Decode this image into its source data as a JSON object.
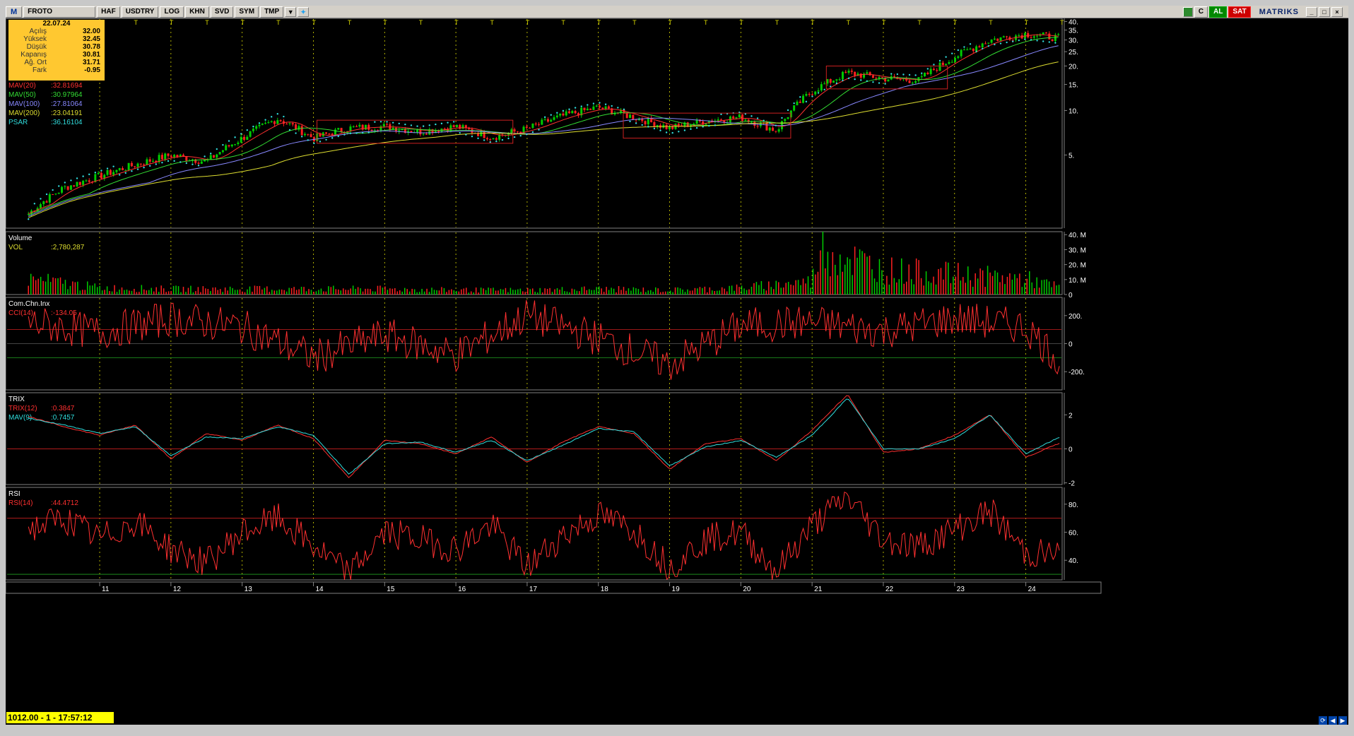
{
  "toolbar": {
    "logo": "M",
    "symbol": "FROTO",
    "buttons": [
      "HAF",
      "USDTRY",
      "LOG",
      "KHN",
      "SVD",
      "SYM",
      "TMP"
    ],
    "al": "AL",
    "sat": "SAT",
    "c": "C",
    "brand": "MATRIKS"
  },
  "info": {
    "date": "22.07.24",
    "rows": [
      {
        "label": "Açılış",
        "value": "32.00"
      },
      {
        "label": "Yüksek",
        "value": "32.45"
      },
      {
        "label": "Düşük",
        "value": "30.78"
      },
      {
        "label": "Kapanış",
        "value": "30.81"
      },
      {
        "label": "Ağ. Ort",
        "value": "31.71"
      },
      {
        "label": "Fark",
        "value": "-0.95"
      }
    ]
  },
  "status": "1012.00 - 1 - 17:57:12",
  "colors": {
    "bg": "#000000",
    "up": "#00cc00",
    "down": "#ff2020",
    "grid": "#d8d800",
    "axis": "#808080"
  },
  "chart_data": [
    {
      "type": "line",
      "title": "FROTO",
      "yscale": "log",
      "ylim": [
        1.6,
        42
      ],
      "yticks": [
        "40.",
        "35.",
        "30.",
        "25.",
        "20.",
        "15.",
        "10.",
        "5."
      ],
      "ytick_values": [
        40,
        35,
        30,
        25,
        20,
        15,
        10,
        5
      ],
      "legend": [
        {
          "name": "MAV(20)",
          "value": ":32.81694",
          "color": "#ff3030"
        },
        {
          "name": "MAV(50)",
          "value": ":30.97964",
          "color": "#33dd33"
        },
        {
          "name": "MAV(100)",
          "value": ":27.81064",
          "color": "#8888ff"
        },
        {
          "name": "MAV(200)",
          "value": ":23.04191",
          "color": "#dddd30"
        },
        {
          "name": "PSAR",
          "value": ":36.16104",
          "color": "#30dddd"
        }
      ],
      "x": [
        2010,
        2010.5,
        2011,
        2011.5,
        2012,
        2012.5,
        2013,
        2013.5,
        2014,
        2014.5,
        2015,
        2015.5,
        2016,
        2016.5,
        2017,
        2017.5,
        2018,
        2018.5,
        2019,
        2019.5,
        2020,
        2020.5,
        2021,
        2021.5,
        2022,
        2022.5,
        2023,
        2023.5,
        2024,
        2024.5
      ],
      "close": [
        2.0,
        3.0,
        3.6,
        4.3,
        5.0,
        4.5,
        6.5,
        8.8,
        6.5,
        7.6,
        7.8,
        7.2,
        7.8,
        6.6,
        7.5,
        9.2,
        10.5,
        9.0,
        7.6,
        8.5,
        9.0,
        7.3,
        13.5,
        18.0,
        16.5,
        16.0,
        23.0,
        30.0,
        33.0,
        30.81
      ]
    },
    {
      "type": "bar",
      "title": "Volume",
      "legend": [
        {
          "name": "VOL",
          "value": ":2,780,287",
          "color": "#dddd30"
        }
      ],
      "yticks": [
        "40. M",
        "30. M",
        "20. M",
        "10. M",
        "0"
      ],
      "ytick_values": [
        40,
        30,
        20,
        10,
        0
      ],
      "ylim": [
        0,
        42
      ],
      "x": [
        2010,
        2011,
        2012,
        2013,
        2014,
        2015,
        2016,
        2017,
        2018,
        2019,
        2020,
        2021,
        2021.1,
        2022,
        2023,
        2024,
        2024.5
      ],
      "values": [
        14,
        6,
        5,
        5,
        5,
        5,
        4,
        4,
        5,
        4,
        6,
        12,
        42,
        22,
        18,
        14,
        6
      ]
    },
    {
      "type": "line",
      "title": "Com.Chn.Inx",
      "legend": [
        {
          "name": "CCI(14)",
          "value": ":-134.05",
          "color": "#ff3030"
        }
      ],
      "yticks": [
        "200.",
        "0",
        "-200."
      ],
      "ytick_values": [
        200,
        0,
        -200
      ],
      "ylim": [
        -330,
        330
      ],
      "bands": [
        100,
        -100
      ],
      "x": [
        2010,
        2011,
        2012,
        2013,
        2014,
        2015,
        2016,
        2017,
        2018,
        2019,
        2020,
        2021,
        2022,
        2023,
        2024,
        2024.5
      ],
      "values": [
        150,
        80,
        180,
        120,
        -100,
        60,
        -80,
        200,
        40,
        -150,
        130,
        150,
        90,
        180,
        120,
        -134.05
      ]
    },
    {
      "type": "line",
      "title": "TRIX",
      "legend": [
        {
          "name": "TRIX(12)",
          "value": ":0.3847",
          "color": "#ff3030"
        },
        {
          "name": "MAV(9)",
          "value": ":0.7457",
          "color": "#30dddd"
        }
      ],
      "yticks": [
        "2",
        "0",
        "-2"
      ],
      "ytick_values": [
        2,
        0,
        -2
      ],
      "ylim": [
        -2.1,
        3.3
      ],
      "x": [
        2010,
        2010.5,
        2011,
        2011.5,
        2012,
        2012.5,
        2013,
        2013.5,
        2014,
        2014.5,
        2015,
        2015.5,
        2016,
        2016.5,
        2017,
        2017.5,
        2018,
        2018.5,
        2019,
        2019.5,
        2020,
        2020.5,
        2021,
        2021.5,
        2022,
        2022.5,
        2023,
        2023.5,
        2024,
        2024.5
      ],
      "values": [
        1.9,
        1.3,
        0.8,
        1.4,
        -0.6,
        0.9,
        0.5,
        1.4,
        0.6,
        -1.7,
        0.5,
        0.3,
        -0.3,
        0.7,
        -0.8,
        0.4,
        1.3,
        0.9,
        -1.2,
        0.3,
        0.6,
        -0.7,
        1.1,
        3.2,
        -0.2,
        0.0,
        0.8,
        2.0,
        -0.5,
        0.3847
      ],
      "signal": [
        1.8,
        1.4,
        0.9,
        1.3,
        -0.4,
        0.7,
        0.6,
        1.3,
        0.8,
        -1.5,
        0.3,
        0.4,
        -0.2,
        0.5,
        -0.7,
        0.2,
        1.2,
        1.0,
        -1.0,
        0.1,
        0.5,
        -0.5,
        0.8,
        3.0,
        0.0,
        0.0,
        0.6,
        2.0,
        -0.3,
        0.7457
      ]
    },
    {
      "type": "line",
      "title": "RSI",
      "legend": [
        {
          "name": "RSI(14)",
          "value": ":44.4712",
          "color": "#ff3030"
        }
      ],
      "yticks": [
        "80.",
        "60.",
        "40."
      ],
      "ytick_values": [
        80,
        60,
        40
      ],
      "ylim": [
        26,
        92
      ],
      "bands": [
        70,
        30
      ],
      "x": [
        2010,
        2010.5,
        2011,
        2011.5,
        2012,
        2012.5,
        2013,
        2013.5,
        2014,
        2014.5,
        2015,
        2015.5,
        2016,
        2016.5,
        2017,
        2017.5,
        2018,
        2018.5,
        2019,
        2019.5,
        2020,
        2020.5,
        2021,
        2021.5,
        2022,
        2022.5,
        2023,
        2023.5,
        2024,
        2024.5
      ],
      "values": [
        62,
        70,
        55,
        68,
        48,
        38,
        60,
        70,
        50,
        30,
        60,
        55,
        48,
        65,
        35,
        58,
        72,
        62,
        35,
        55,
        60,
        32,
        65,
        85,
        55,
        50,
        62,
        75,
        45,
        44.4712
      ]
    }
  ],
  "x_axis": {
    "labels": [
      "11",
      "12",
      "13",
      "14",
      "15",
      "16",
      "17",
      "18",
      "19",
      "20",
      "21",
      "22",
      "23",
      "24"
    ],
    "values": [
      2011,
      2012,
      2013,
      2014,
      2015,
      2016,
      2017,
      2018,
      2019,
      2020,
      2021,
      2022,
      2023,
      2024
    ],
    "range": [
      2009.7,
      2024.5
    ]
  }
}
